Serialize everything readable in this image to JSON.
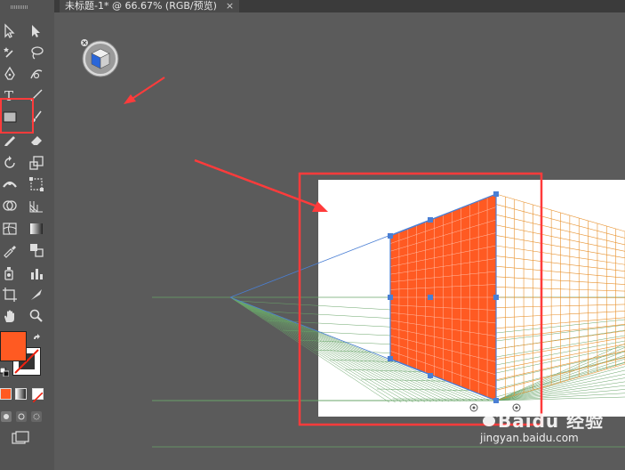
{
  "document_tab": {
    "title": "未标题-1* @ 66.67% (RGB/预览)",
    "close_glyph": "×"
  },
  "colors": {
    "fill": "#ff5a22",
    "grid_orange": "#e8922e",
    "grid_blue": "#4a7fd4",
    "grid_green": "#6aa56a",
    "annotation_red": "#ff3b3b"
  },
  "watermark": {
    "brand": "Baidu 经验",
    "url": "jingyan.baidu.com"
  },
  "tools": [
    "selection-tool-icon",
    "direct-selection-tool-icon",
    "magic-wand-tool-icon",
    "lasso-tool-icon",
    "pen-tool-icon",
    "curvature-tool-icon",
    "type-tool-icon",
    "line-segment-tool-icon",
    "rectangle-tool-icon",
    "paintbrush-tool-icon",
    "pencil-tool-icon",
    "eraser-tool-icon",
    "rotate-tool-icon",
    "scale-tool-icon",
    "width-tool-icon",
    "free-transform-tool-icon",
    "shape-builder-tool-icon",
    "perspective-grid-tool-icon",
    "mesh-tool-icon",
    "gradient-tool-icon",
    "eyedropper-tool-icon",
    "blend-tool-icon",
    "symbol-sprayer-tool-icon",
    "column-graph-tool-icon",
    "artboard-tool-icon",
    "slice-tool-icon",
    "hand-tool-icon",
    "zoom-tool-icon"
  ]
}
